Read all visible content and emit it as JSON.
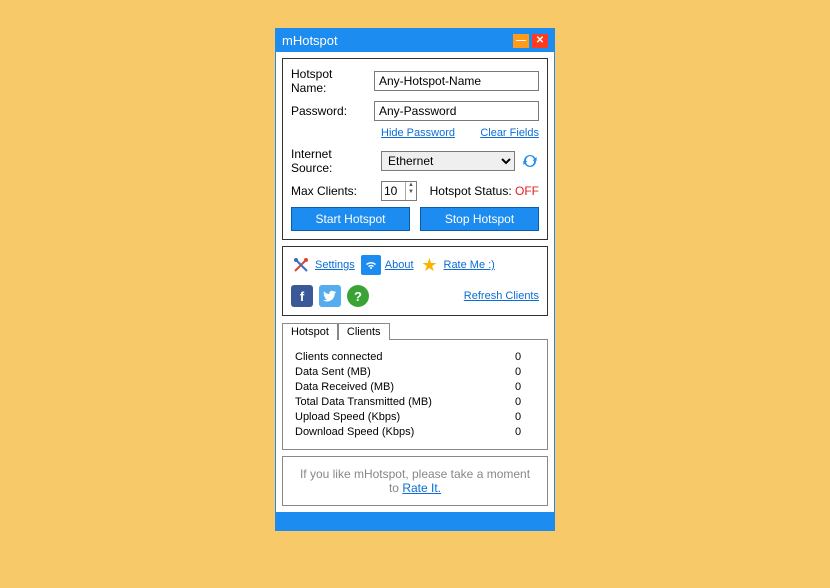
{
  "window": {
    "title": "mHotspot"
  },
  "form": {
    "hotspot_name_label": "Hotspot Name:",
    "hotspot_name_value": "Any-Hotspot-Name",
    "password_label": "Password:",
    "password_value": "Any-Password",
    "hide_password": "Hide Password",
    "clear_fields": "Clear Fields",
    "internet_source_label": "Internet Source:",
    "internet_source_value": "Ethernet",
    "max_clients_label": "Max Clients:",
    "max_clients_value": "10",
    "hotspot_status_label": "Hotspot Status:",
    "hotspot_status_value": "OFF",
    "start_btn": "Start Hotspot",
    "stop_btn": "Stop Hotspot"
  },
  "links": {
    "settings": "Settings",
    "about": "About",
    "rate_me": "Rate Me :)",
    "refresh_clients": "Refresh Clients"
  },
  "tabs": {
    "hotspot": "Hotspot",
    "clients": "Clients"
  },
  "stats": [
    {
      "label": "Clients connected",
      "value": "0"
    },
    {
      "label": "Data Sent (MB)",
      "value": "0"
    },
    {
      "label": "Data Received (MB)",
      "value": "0"
    },
    {
      "label": "Total Data Transmitted (MB)",
      "value": "0"
    },
    {
      "label": "Upload Speed (Kbps)",
      "value": "0"
    },
    {
      "label": "Download Speed (Kbps)",
      "value": "0"
    }
  ],
  "footer": {
    "text": "If you like mHotspot, please take a moment to",
    "link": "Rate It."
  }
}
